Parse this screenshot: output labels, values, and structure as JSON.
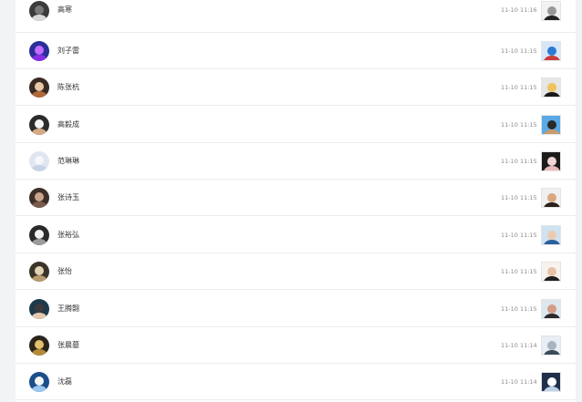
{
  "notifications": [
    {
      "name": "高寒",
      "time": "11-10 11:16",
      "avatar": [
        "#3b3b3b",
        "#d9d9d9",
        "#777"
      ],
      "thumb": [
        "#f2f2f2",
        "#222",
        "#999"
      ]
    },
    {
      "name": "刘子雷",
      "time": "11-10 11:15",
      "avatar": [
        "#2a2f99",
        "#8a2ee6",
        "#c56cff"
      ],
      "thumb": [
        "#d7e7f7",
        "#cc3b3b",
        "#2b7bd1"
      ]
    },
    {
      "name": "陈张杭",
      "time": "11-10 11:15",
      "avatar": [
        "#3a2a24",
        "#b06a3a",
        "#e8c6a8"
      ],
      "thumb": [
        "#e6e6e6",
        "#1a1a1a",
        "#f0c25a"
      ]
    },
    {
      "name": "高毅成",
      "time": "11-10 11:15",
      "avatar": [
        "#2b2b2b",
        "#d7aa86",
        "#f4f4f4"
      ],
      "thumb": [
        "#5aa9e6",
        "#c99b6b",
        "#2a2a2a"
      ]
    },
    {
      "name": "范琳琳",
      "time": "11-10 11:15",
      "avatar": [
        "#dfe6f0",
        "#c8d3e4",
        "#f5f7fb"
      ],
      "thumb": [
        "#1c1c1c",
        "#e9bcbc",
        "#f2d6d6"
      ]
    },
    {
      "name": "张诗玉",
      "time": "11-10 11:15",
      "avatar": [
        "#3e2f28",
        "#7a5a4a",
        "#c9a38a"
      ],
      "thumb": [
        "#f0f0f0",
        "#2a201c",
        "#d8a87f"
      ]
    },
    {
      "name": "张裕弘",
      "time": "11-10 11:15",
      "avatar": [
        "#2a2a2a",
        "#9b9b9b",
        "#f1f1f1"
      ],
      "thumb": [
        "#cfe3f2",
        "#2b5f9b",
        "#eecbb0"
      ]
    },
    {
      "name": "张怡",
      "time": "11-10 11:15",
      "avatar": [
        "#3a3328",
        "#b79a6f",
        "#e3d2b4"
      ],
      "thumb": [
        "#f7f2ee",
        "#1f1f1f",
        "#e6c3a8"
      ]
    },
    {
      "name": "王腾翾",
      "time": "11-10 11:15",
      "avatar": [
        "#1e3a4a",
        "#e6c8b0",
        "#3b3b3b"
      ],
      "thumb": [
        "#dde7f0",
        "#2a2a2a",
        "#d59c86"
      ]
    },
    {
      "name": "张晨墓",
      "time": "11-10 11:14",
      "avatar": [
        "#2a241b",
        "#b58b3b",
        "#e1c16a"
      ],
      "thumb": [
        "#e8eef4",
        "#3b4a5c",
        "#a8b3c0"
      ]
    },
    {
      "name": "沈磊",
      "time": "11-10 11:14",
      "avatar": [
        "#1b4f8a",
        "#9bc8f0",
        "#f5f5f5"
      ],
      "thumb": [
        "#1f2f4a",
        "#bcd2e8",
        "#ffffff"
      ]
    }
  ]
}
